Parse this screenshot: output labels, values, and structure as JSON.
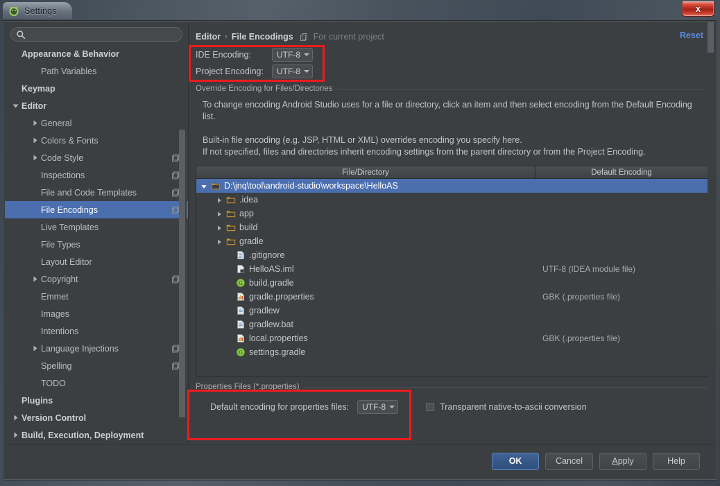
{
  "window": {
    "title": "Settings",
    "app_icon": "android-studio-icon",
    "close_label": "x"
  },
  "sidebar": {
    "search": {
      "value": "",
      "placeholder": "",
      "icon": "search-icon"
    },
    "items": [
      {
        "label": "Appearance & Behavior",
        "level": 0,
        "bold": true,
        "arrow": "none",
        "copy": false
      },
      {
        "label": "Path Variables",
        "level": 1,
        "bold": false,
        "arrow": "none",
        "copy": false
      },
      {
        "label": "Keymap",
        "level": 0,
        "bold": true,
        "arrow": "none",
        "copy": false
      },
      {
        "label": "Editor",
        "level": 0,
        "bold": true,
        "arrow": "down",
        "copy": false
      },
      {
        "label": "General",
        "level": 1,
        "bold": false,
        "arrow": "right",
        "copy": false
      },
      {
        "label": "Colors & Fonts",
        "level": 1,
        "bold": false,
        "arrow": "right",
        "copy": false
      },
      {
        "label": "Code Style",
        "level": 1,
        "bold": false,
        "arrow": "right",
        "copy": true
      },
      {
        "label": "Inspections",
        "level": 1,
        "bold": false,
        "arrow": "none",
        "copy": true
      },
      {
        "label": "File and Code Templates",
        "level": 1,
        "bold": false,
        "arrow": "none",
        "copy": true
      },
      {
        "label": "File Encodings",
        "level": 1,
        "bold": false,
        "arrow": "none",
        "copy": true,
        "selected": true
      },
      {
        "label": "Live Templates",
        "level": 1,
        "bold": false,
        "arrow": "none",
        "copy": false
      },
      {
        "label": "File Types",
        "level": 1,
        "bold": false,
        "arrow": "none",
        "copy": false
      },
      {
        "label": "Layout Editor",
        "level": 1,
        "bold": false,
        "arrow": "none",
        "copy": false
      },
      {
        "label": "Copyright",
        "level": 1,
        "bold": false,
        "arrow": "right",
        "copy": true
      },
      {
        "label": "Emmet",
        "level": 1,
        "bold": false,
        "arrow": "none",
        "copy": false
      },
      {
        "label": "Images",
        "level": 1,
        "bold": false,
        "arrow": "none",
        "copy": false
      },
      {
        "label": "Intentions",
        "level": 1,
        "bold": false,
        "arrow": "none",
        "copy": false
      },
      {
        "label": "Language Injections",
        "level": 1,
        "bold": false,
        "arrow": "right",
        "copy": true
      },
      {
        "label": "Spelling",
        "level": 1,
        "bold": false,
        "arrow": "none",
        "copy": true
      },
      {
        "label": "TODO",
        "level": 1,
        "bold": false,
        "arrow": "none",
        "copy": false
      },
      {
        "label": "Plugins",
        "level": 0,
        "bold": true,
        "arrow": "none",
        "copy": false
      },
      {
        "label": "Version Control",
        "level": 0,
        "bold": true,
        "arrow": "right",
        "copy": false
      },
      {
        "label": "Build, Execution, Deployment",
        "level": 0,
        "bold": true,
        "arrow": "right",
        "copy": false
      }
    ]
  },
  "main": {
    "breadcrumb": {
      "parent": "Editor",
      "separator": "›",
      "current": "File Encodings",
      "note": "For current project",
      "note_icon": "copy-scope-icon"
    },
    "reset_label": "Reset",
    "ide_encoding": {
      "label": "IDE Encoding:",
      "value": "UTF-8"
    },
    "project_encoding": {
      "label": "Project Encoding:",
      "value": "UTF-8"
    },
    "override_group_title": "Override Encoding for Files/Directories",
    "paragraphs": [
      "To change encoding Android Studio uses for a file or directory, click an item and then select encoding from the Default Encoding list.",
      "Built-in file encoding (e.g. JSP, HTML or XML) overrides encoding you specify here.",
      "If not specified, files and directories inherit encoding settings from the parent directory or from the Project Encoding."
    ],
    "table": {
      "columns": [
        "File/Directory",
        "Default Encoding"
      ],
      "rows": [
        {
          "name": "D:\\jnq\\tool\\android-studio\\workspace\\HelloAS",
          "encoding": "",
          "indent": 0,
          "arrow": "down",
          "icon": "folder-icon",
          "selected": true
        },
        {
          "name": ".idea",
          "encoding": "",
          "indent": 1,
          "arrow": "right",
          "icon": "folder-icon"
        },
        {
          "name": "app",
          "encoding": "",
          "indent": 1,
          "arrow": "right",
          "icon": "folder-icon"
        },
        {
          "name": "build",
          "encoding": "",
          "indent": 1,
          "arrow": "right",
          "icon": "folder-icon"
        },
        {
          "name": "gradle",
          "encoding": "",
          "indent": 1,
          "arrow": "right",
          "icon": "folder-icon"
        },
        {
          "name": ".gitignore",
          "encoding": "",
          "indent": 2,
          "arrow": "none",
          "icon": "text-file-icon"
        },
        {
          "name": "HelloAS.iml",
          "encoding": "UTF-8 (IDEA module file)",
          "indent": 2,
          "arrow": "none",
          "icon": "iml-file-icon"
        },
        {
          "name": "build.gradle",
          "encoding": "",
          "indent": 2,
          "arrow": "none",
          "icon": "gradle-file-icon"
        },
        {
          "name": "gradle.properties",
          "encoding": "GBK (.properties file)",
          "indent": 2,
          "arrow": "none",
          "icon": "properties-file-icon"
        },
        {
          "name": "gradlew",
          "encoding": "",
          "indent": 2,
          "arrow": "none",
          "icon": "text-file-icon"
        },
        {
          "name": "gradlew.bat",
          "encoding": "",
          "indent": 2,
          "arrow": "none",
          "icon": "text-file-icon"
        },
        {
          "name": "local.properties",
          "encoding": "GBK (.properties file)",
          "indent": 2,
          "arrow": "none",
          "icon": "properties-file-icon"
        },
        {
          "name": "settings.gradle",
          "encoding": "",
          "indent": 2,
          "arrow": "none",
          "icon": "gradle-file-icon"
        }
      ]
    },
    "properties_group_title": "Properties Files (*.properties)",
    "properties_default_label": "Default encoding for properties files:",
    "properties_default_value": "UTF-8",
    "native_ascii_label": "Transparent native-to-ascii conversion",
    "native_ascii_checked": false
  },
  "footer": {
    "ok": "OK",
    "cancel": "Cancel",
    "apply_prefix": "A",
    "apply_rest": "pply",
    "help": "Help"
  },
  "colors": {
    "accent_selection": "#4b6eaf",
    "link": "#5a8ada",
    "annotation": "#ee1b1b",
    "panel_bg": "#3c3f41"
  }
}
